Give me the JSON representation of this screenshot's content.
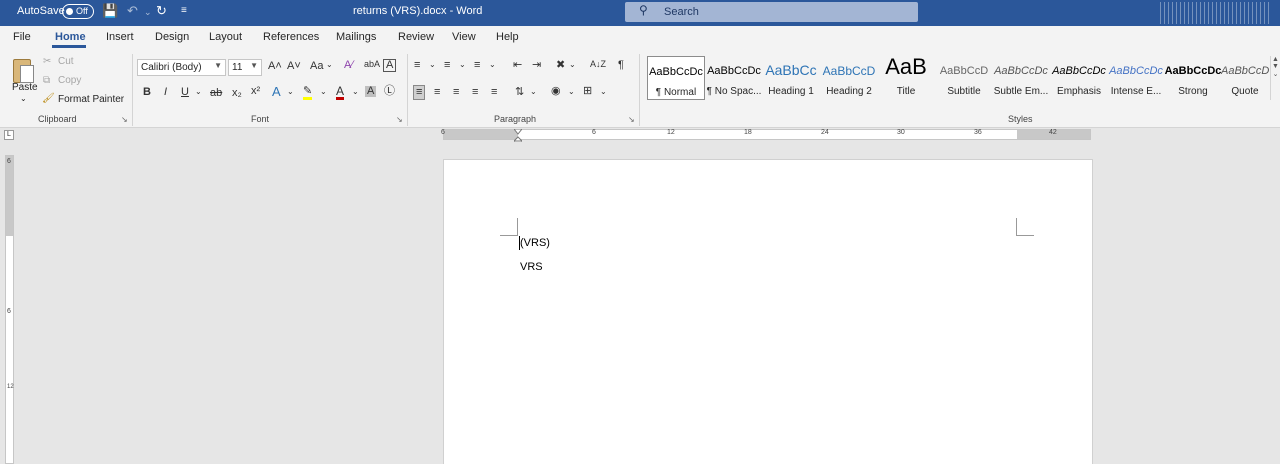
{
  "titlebar": {
    "autosave_label": "AutoSave",
    "autosave_state": "Off",
    "doc_title": "returns (VRS).docx  -  Word",
    "search_label": "Search"
  },
  "tabs": [
    "File",
    "Home",
    "Insert",
    "Design",
    "Layout",
    "References",
    "Mailings",
    "Review",
    "View",
    "Help"
  ],
  "active_tab": "Home",
  "clipboard": {
    "paste": "Paste",
    "cut": "Cut",
    "copy": "Copy",
    "format_painter": "Format Painter",
    "label": "Clipboard"
  },
  "font": {
    "family": "Calibri (Body)",
    "size": "11",
    "grow": "A˄",
    "shrink": "A˅",
    "case": "Aa",
    "bold": "B",
    "italic": "I",
    "underline": "U",
    "strike": "ab",
    "sub": "x₂",
    "sup": "x²",
    "label": "Font"
  },
  "paragraph": {
    "label": "Paragraph",
    "pilcrow": "¶",
    "sort": "A↓Z"
  },
  "styles": {
    "label": "Styles",
    "items": [
      {
        "preview": "AaBbCcDc",
        "name": "¶ Normal"
      },
      {
        "preview": "AaBbCcDc",
        "name": "¶ No Spac..."
      },
      {
        "preview": "AaBbCc",
        "name": "Heading 1"
      },
      {
        "preview": "AaBbCcD",
        "name": "Heading 2"
      },
      {
        "preview": "AaB",
        "name": "Title"
      },
      {
        "preview": "AaBbCcD",
        "name": "Subtitle"
      },
      {
        "preview": "AaBbCcDc",
        "name": "Subtle Em..."
      },
      {
        "preview": "AaBbCcDc",
        "name": "Emphasis"
      },
      {
        "preview": "AaBbCcDc",
        "name": "Intense E..."
      },
      {
        "preview": "AaBbCcDc",
        "name": "Strong"
      },
      {
        "preview": "AaBbCcDc",
        "name": "Quote"
      }
    ]
  },
  "ruler": {
    "h_numbers": [
      "6",
      "6",
      "12",
      "18",
      "24",
      "30",
      "36",
      "42"
    ],
    "v_numbers": [
      "6",
      "6",
      "12"
    ],
    "tab_selector": "L"
  },
  "document": {
    "lines": [
      "(VRS)",
      "VRS"
    ]
  }
}
